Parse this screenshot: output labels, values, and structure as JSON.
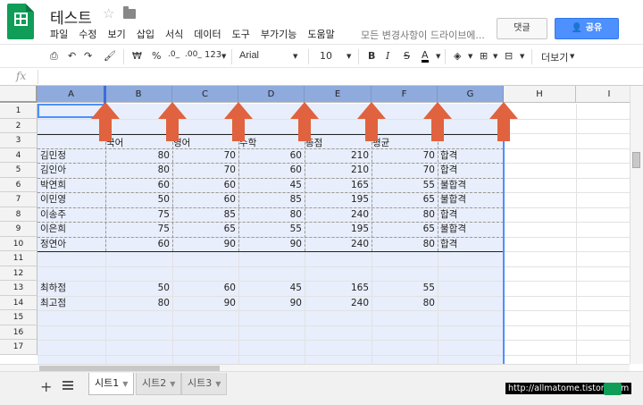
{
  "app": {
    "doc_title": "테스트",
    "menu": [
      "파일",
      "수정",
      "보기",
      "삽입",
      "서식",
      "데이터",
      "도구",
      "부가기능",
      "도움말"
    ],
    "save_status": "모든 변경사항이 드라이브에...",
    "comment_label": "댓글",
    "share_label": "공유"
  },
  "toolbar": {
    "currency": "₩",
    "percent": "%",
    "dec_less": ".0_",
    "dec_more": ".00_",
    "format_more": "123",
    "font": "Arial",
    "font_size": "10",
    "bold": "B",
    "italic": "I",
    "strike": "S",
    "text_color": "A",
    "more": "더보기"
  },
  "formula_bar": {
    "fx": "fx",
    "value": ""
  },
  "columns": [
    "A",
    "B",
    "C",
    "D",
    "E",
    "F",
    "G",
    "H",
    "I"
  ],
  "rows": [
    "1",
    "2",
    "3",
    "4",
    "5",
    "6",
    "7",
    "8",
    "9",
    "10",
    "11",
    "12",
    "13",
    "14",
    "15",
    "16",
    "17"
  ],
  "headers_row3": {
    "B": "국어",
    "C": "영어",
    "D": "수학",
    "E": "총점",
    "F": "평균"
  },
  "students": [
    {
      "name": "김민정",
      "kor": "80",
      "eng": "70",
      "math": "60",
      "total": "210",
      "avg": "70",
      "result": "합격"
    },
    {
      "name": "김인아",
      "kor": "80",
      "eng": "70",
      "math": "60",
      "total": "210",
      "avg": "70",
      "result": "합격"
    },
    {
      "name": "박연희",
      "kor": "60",
      "eng": "60",
      "math": "45",
      "total": "165",
      "avg": "55",
      "result": "불합격"
    },
    {
      "name": "이민영",
      "kor": "50",
      "eng": "60",
      "math": "85",
      "total": "195",
      "avg": "65",
      "result": "불합격"
    },
    {
      "name": "이송주",
      "kor": "75",
      "eng": "85",
      "math": "80",
      "total": "240",
      "avg": "80",
      "result": "합격"
    },
    {
      "name": "이은희",
      "kor": "75",
      "eng": "65",
      "math": "55",
      "total": "195",
      "avg": "65",
      "result": "불합격"
    },
    {
      "name": "정연아",
      "kor": "60",
      "eng": "90",
      "math": "90",
      "total": "240",
      "avg": "80",
      "result": "합격"
    }
  ],
  "summary": [
    {
      "name": "최하점",
      "kor": "50",
      "eng": "60",
      "math": "45",
      "total": "165",
      "avg": "55"
    },
    {
      "name": "최고점",
      "kor": "80",
      "eng": "90",
      "math": "90",
      "total": "240",
      "avg": "80"
    }
  ],
  "sheets": [
    "시트1",
    "시트2",
    "시트3"
  ],
  "watermark": "http://allmatome.tistory.com",
  "colors": {
    "accent": "#4d90fe",
    "selected_header": "#8faadc",
    "arrow": "#e0623e",
    "brand": "#0f9d58"
  }
}
